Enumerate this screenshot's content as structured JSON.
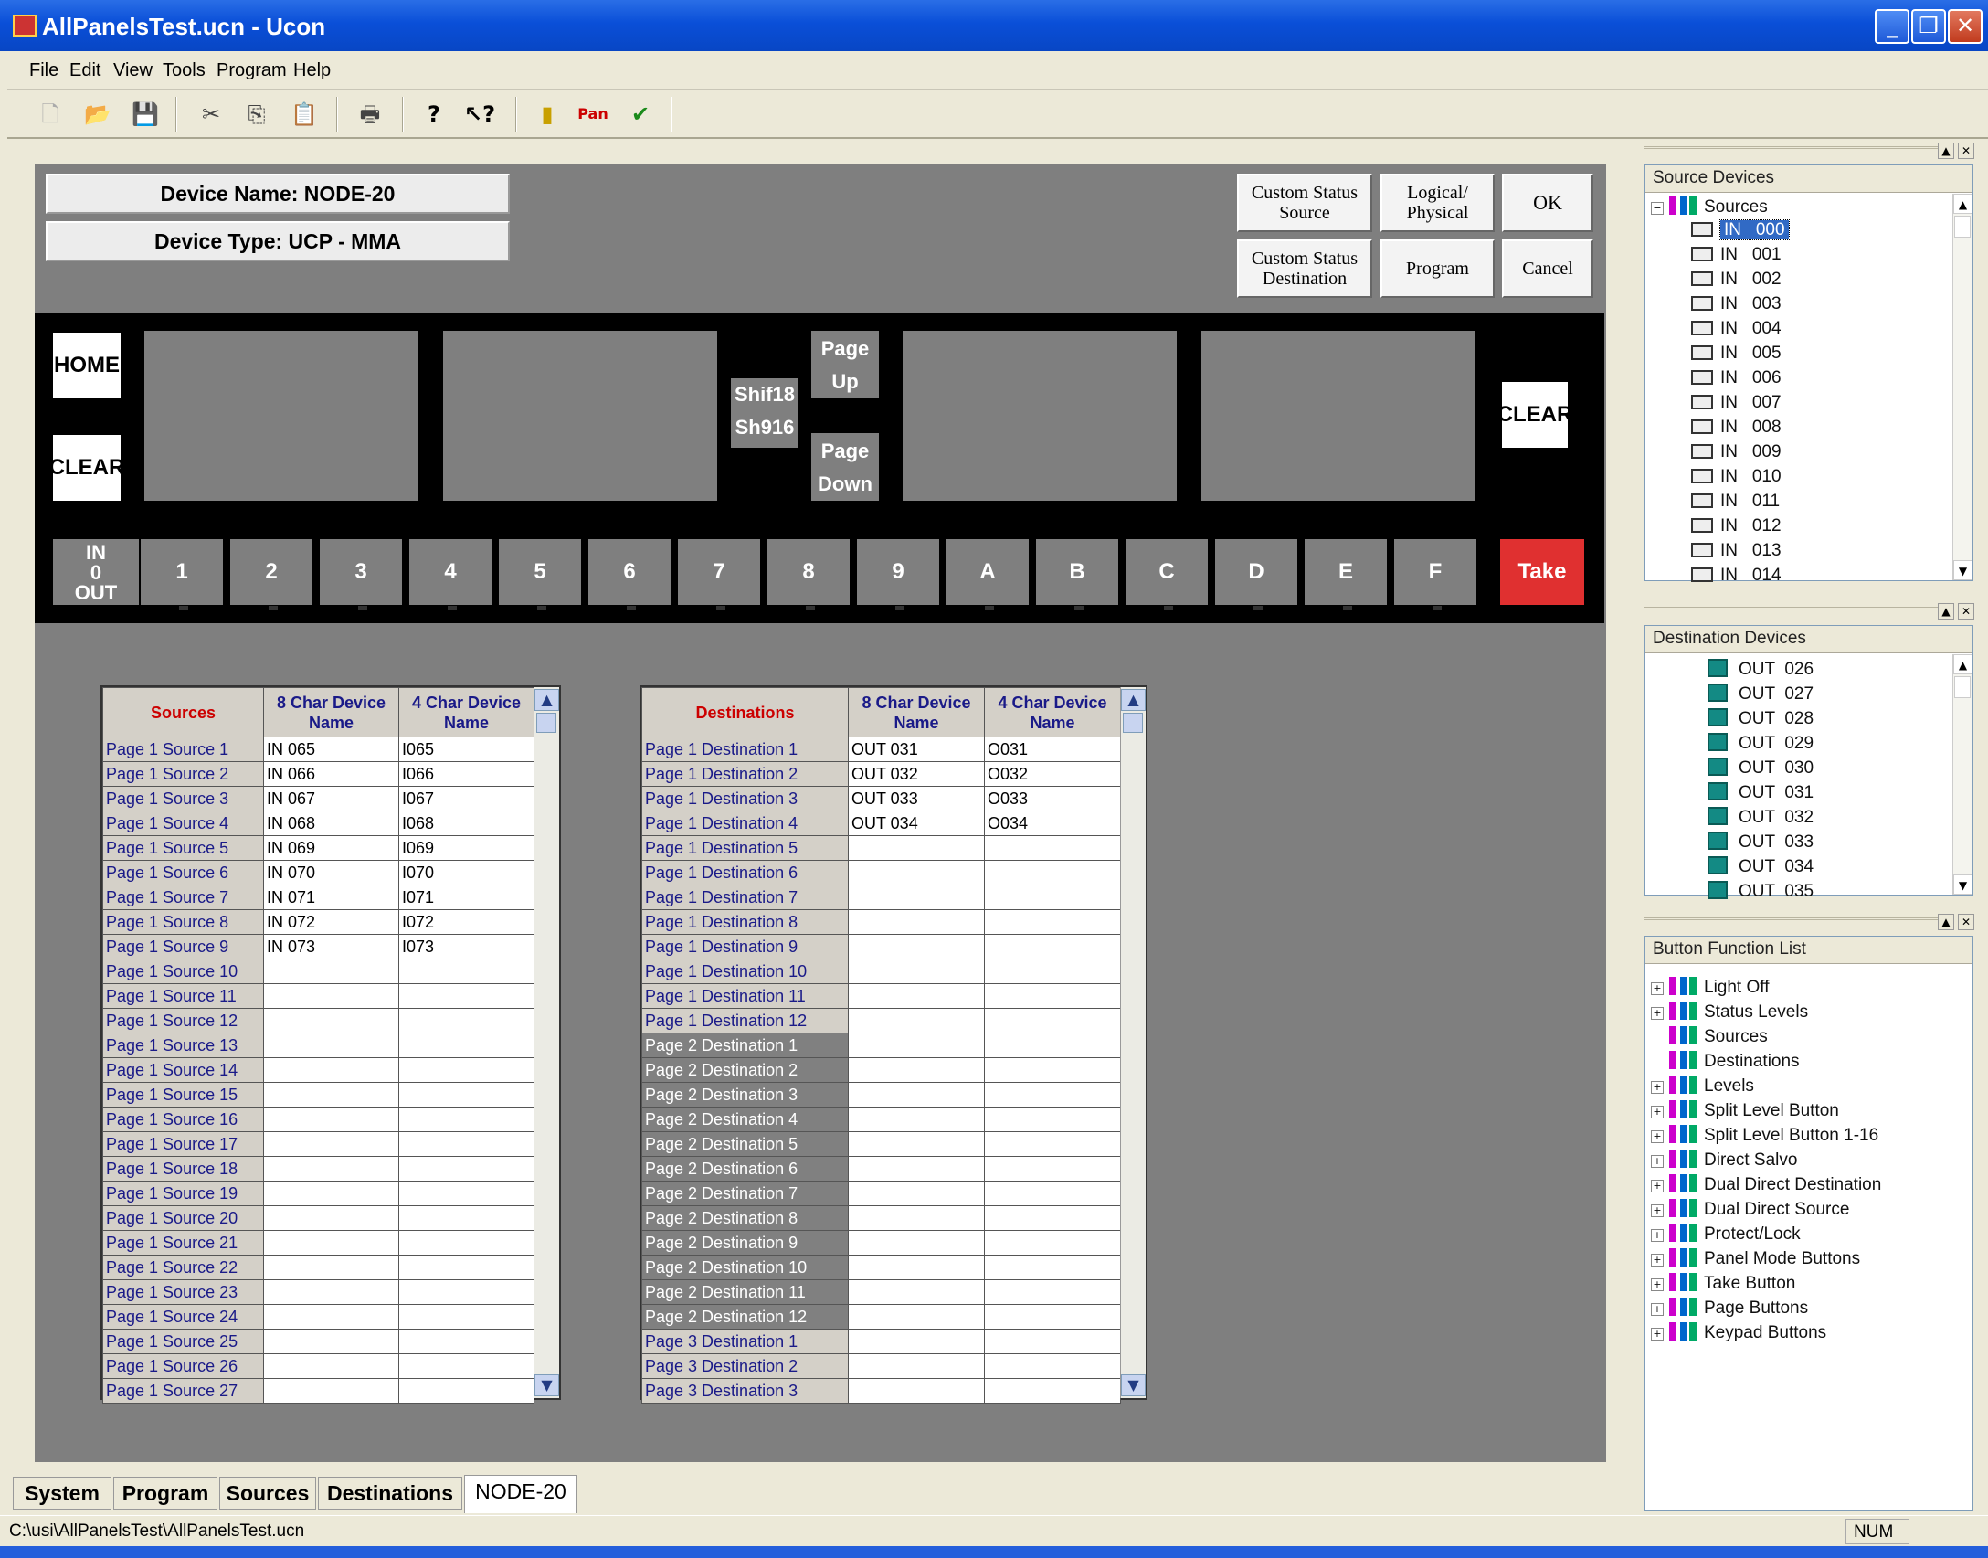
{
  "window": {
    "title": "AllPanelsTest.ucn - Ucon",
    "min": "_",
    "max": "❐",
    "close": "✕"
  },
  "menu": [
    "File",
    "Edit",
    "View",
    "Tools",
    "Program",
    "Help"
  ],
  "toolbar_icons": [
    "new-icon",
    "open-icon",
    "save-icon",
    "cut-icon",
    "copy-icon",
    "paste-icon",
    "print-icon",
    "help-icon",
    "context-help-icon",
    "upload-icon",
    "pan-icon",
    "check-icon"
  ],
  "device": {
    "name": "Device Name: NODE-20",
    "type": "Device Type: UCP - MMA"
  },
  "top_buttons": {
    "custom_src": "Custom Status Source",
    "logical": "Logical/ Physical",
    "ok": "OK",
    "custom_dst": "Custom Status Destination",
    "program": "Program",
    "cancel": "Cancel"
  },
  "panel": {
    "home": "HOME",
    "clear_left": "CLEAR",
    "shift1": "Shif18",
    "shift2": "Sh916",
    "page_up": "Page Up",
    "page_down": "Page Down",
    "clear_right": "CLEAR",
    "inout_in": "IN",
    "inout_mid": "0",
    "inout_out": "OUT",
    "keys": [
      "1",
      "2",
      "3",
      "4",
      "5",
      "6",
      "7",
      "8",
      "9",
      "A",
      "B",
      "C",
      "D",
      "E",
      "F"
    ],
    "take": "Take",
    "take_color": "#e03030"
  },
  "sources_table": {
    "headers": [
      "Sources",
      "8 Char Device Name",
      "4 Char Device Name"
    ],
    "rows": [
      [
        "Page 1 Source   1",
        "IN   065",
        "I065"
      ],
      [
        "Page 1 Source   2",
        "IN   066",
        "I066"
      ],
      [
        "Page 1 Source   3",
        "IN   067",
        "I067"
      ],
      [
        "Page 1 Source   4",
        "IN   068",
        "I068"
      ],
      [
        "Page 1 Source   5",
        "IN   069",
        "I069"
      ],
      [
        "Page 1 Source   6",
        "IN   070",
        "I070"
      ],
      [
        "Page 1 Source   7",
        "IN   071",
        "I071"
      ],
      [
        "Page 1 Source   8",
        "IN   072",
        "I072"
      ],
      [
        "Page 1 Source   9",
        "IN   073",
        "I073"
      ],
      [
        "Page 1 Source   10",
        "",
        ""
      ],
      [
        "Page 1 Source   11",
        "",
        ""
      ],
      [
        "Page 1 Source   12",
        "",
        ""
      ],
      [
        "Page 1 Source   13",
        "",
        ""
      ],
      [
        "Page 1 Source   14",
        "",
        ""
      ],
      [
        "Page 1 Source   15",
        "",
        ""
      ],
      [
        "Page 1 Source   16",
        "",
        ""
      ],
      [
        "Page 1 Source   17",
        "",
        ""
      ],
      [
        "Page 1 Source   18",
        "",
        ""
      ],
      [
        "Page 1 Source   19",
        "",
        ""
      ],
      [
        "Page 1 Source   20",
        "",
        ""
      ],
      [
        "Page 1 Source   21",
        "",
        ""
      ],
      [
        "Page 1 Source   22",
        "",
        ""
      ],
      [
        "Page 1 Source   23",
        "",
        ""
      ],
      [
        "Page 1 Source   24",
        "",
        ""
      ],
      [
        "Page 1 Source   25",
        "",
        ""
      ],
      [
        "Page 1 Source   26",
        "",
        ""
      ],
      [
        "Page 1 Source   27",
        "",
        ""
      ]
    ]
  },
  "dest_table": {
    "headers": [
      "Destinations",
      "8 Char Device Name",
      "4 Char Device Name"
    ],
    "rows": [
      [
        "Page 1 Destination   1",
        "OUT  031",
        "O031",
        false
      ],
      [
        "Page 1 Destination   2",
        "OUT  032",
        "O032",
        false
      ],
      [
        "Page 1 Destination   3",
        "OUT  033",
        "O033",
        false
      ],
      [
        "Page 1 Destination   4",
        "OUT  034",
        "O034",
        false
      ],
      [
        "Page 1 Destination   5",
        "",
        "",
        false
      ],
      [
        "Page 1 Destination   6",
        "",
        "",
        false
      ],
      [
        "Page 1 Destination   7",
        "",
        "",
        false
      ],
      [
        "Page 1 Destination   8",
        "",
        "",
        false
      ],
      [
        "Page 1 Destination   9",
        "",
        "",
        false
      ],
      [
        "Page 1 Destination   10",
        "",
        "",
        false
      ],
      [
        "Page 1 Destination   11",
        "",
        "",
        false
      ],
      [
        "Page 1 Destination   12",
        "",
        "",
        false
      ],
      [
        "Page 2 Destination   1",
        "",
        "",
        true
      ],
      [
        "Page 2 Destination   2",
        "",
        "",
        true
      ],
      [
        "Page 2 Destination   3",
        "",
        "",
        true
      ],
      [
        "Page 2 Destination   4",
        "",
        "",
        true
      ],
      [
        "Page 2 Destination   5",
        "",
        "",
        true
      ],
      [
        "Page 2 Destination   6",
        "",
        "",
        true
      ],
      [
        "Page 2 Destination   7",
        "",
        "",
        true
      ],
      [
        "Page 2 Destination   8",
        "",
        "",
        true
      ],
      [
        "Page 2 Destination   9",
        "",
        "",
        true
      ],
      [
        "Page 2 Destination   10",
        "",
        "",
        true
      ],
      [
        "Page 2 Destination   11",
        "",
        "",
        true
      ],
      [
        "Page 2 Destination   12",
        "",
        "",
        true
      ],
      [
        "Page 3 Destination   1",
        "",
        "",
        false
      ],
      [
        "Page 3 Destination   2",
        "",
        "",
        false
      ],
      [
        "Page 3 Destination   3",
        "",
        "",
        false
      ]
    ]
  },
  "tabs": [
    "System",
    "Program",
    "Sources",
    "Destinations",
    "NODE-20"
  ],
  "status": {
    "path": "C:\\usi\\AllPanelsTest\\AllPanelsTest.ucn",
    "num": "NUM"
  },
  "source_devices": {
    "title": "Source Devices",
    "root": "Sources",
    "items": [
      "IN   000",
      "IN   001",
      "IN   002",
      "IN   003",
      "IN   004",
      "IN   005",
      "IN   006",
      "IN   007",
      "IN   008",
      "IN   009",
      "IN   010",
      "IN   011",
      "IN   012",
      "IN   013",
      "IN   014"
    ]
  },
  "dest_devices": {
    "title": "Destination Devices",
    "items": [
      "OUT  026",
      "OUT  027",
      "OUT  028",
      "OUT  029",
      "OUT  030",
      "OUT  031",
      "OUT  032",
      "OUT  033",
      "OUT  034",
      "OUT  035"
    ]
  },
  "button_functions": {
    "title": "Button Function List",
    "items": [
      {
        "label": "Light Off",
        "expand": true
      },
      {
        "label": "Status Levels",
        "expand": true
      },
      {
        "label": "Sources",
        "expand": false
      },
      {
        "label": "Destinations",
        "expand": false
      },
      {
        "label": "Levels",
        "expand": true
      },
      {
        "label": "Split Level Button",
        "expand": true
      },
      {
        "label": "Split Level Button 1-16",
        "expand": true
      },
      {
        "label": "Direct Salvo",
        "expand": true
      },
      {
        "label": "Dual Direct Destination",
        "expand": true
      },
      {
        "label": "Dual Direct Source",
        "expand": true
      },
      {
        "label": "Protect/Lock",
        "expand": true
      },
      {
        "label": "Panel Mode Buttons",
        "expand": true
      },
      {
        "label": "Take Button",
        "expand": true
      },
      {
        "label": "Page Buttons",
        "expand": true
      },
      {
        "label": "Keypad Buttons",
        "expand": true
      }
    ]
  }
}
